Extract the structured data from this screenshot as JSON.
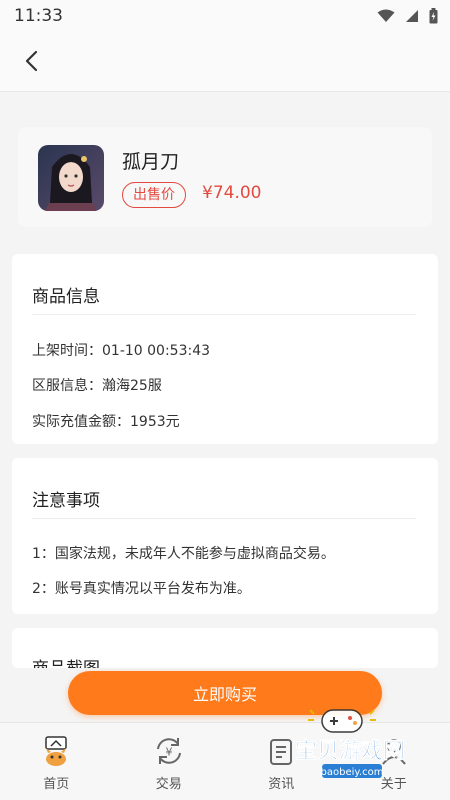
{
  "status": {
    "time": "11:33"
  },
  "product": {
    "name": "孤月刀",
    "price_label": "出售价",
    "price": "¥74.00"
  },
  "info_section": {
    "title": "商品信息",
    "lines": [
      "上架时间：01-10 00:53:43",
      "区服信息：瀚海25服",
      "实际充值金额：1953元"
    ]
  },
  "notice_section": {
    "title": "注意事项",
    "lines": [
      "1：国家法规，未成年人不能参与虚拟商品交易。",
      "2：账号真实情况以平台发布为准。"
    ]
  },
  "screenshot_section": {
    "title": "商品截图"
  },
  "buy_button": "立即购买",
  "tabs": [
    {
      "label": "首页",
      "icon": "home-icon"
    },
    {
      "label": "交易",
      "icon": "exchange-icon"
    },
    {
      "label": "资讯",
      "icon": "news-icon"
    },
    {
      "label": "关于",
      "icon": "about-icon"
    }
  ],
  "watermark": {
    "text": "宝贝游戏网",
    "url": "baobeiy.com"
  },
  "colors": {
    "accent": "#ff7a1a",
    "price": "#e34a3f"
  }
}
